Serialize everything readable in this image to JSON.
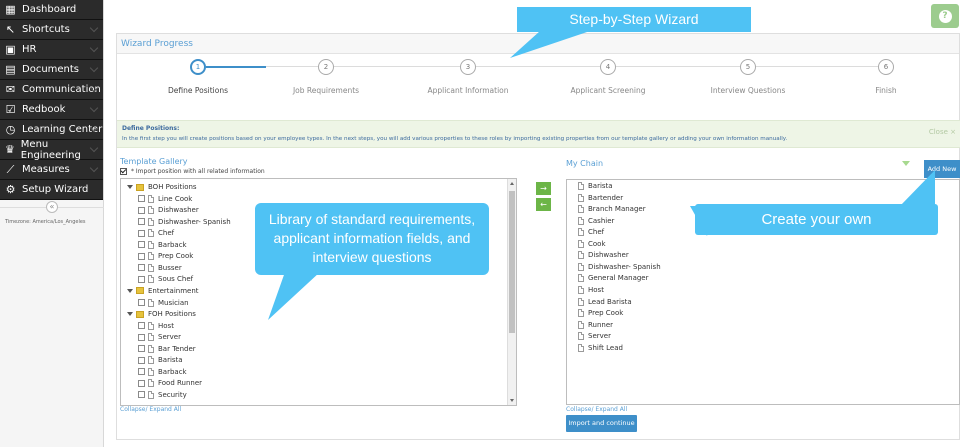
{
  "sidebar": {
    "items": [
      {
        "label": "Dashboard",
        "icon": "grid-icon"
      },
      {
        "label": "Shortcuts",
        "icon": "arrow-icon"
      },
      {
        "label": "HR",
        "icon": "id-card-icon"
      },
      {
        "label": "Documents",
        "icon": "documents-icon"
      },
      {
        "label": "Communication",
        "icon": "envelope-icon"
      },
      {
        "label": "Redbook",
        "icon": "checkbox-icon"
      },
      {
        "label": "Learning Center",
        "icon": "timer-icon"
      },
      {
        "label": "Menu Engineering",
        "icon": "chef-hat-icon"
      },
      {
        "label": "Measures",
        "icon": "ruler-icon"
      },
      {
        "label": "Setup Wizard",
        "icon": "gears-icon"
      }
    ],
    "collapse_glyph": "«",
    "timezone": "Timezone: America/Los_Angeles"
  },
  "help": {
    "glyph": "?"
  },
  "panel": {
    "title": "Wizard Progress"
  },
  "steps": [
    {
      "number": "1",
      "label": "Define Positions"
    },
    {
      "number": "2",
      "label": "Job Requirements"
    },
    {
      "number": "3",
      "label": "Applicant Information"
    },
    {
      "number": "4",
      "label": "Applicant Screening"
    },
    {
      "number": "5",
      "label": "Interview Questions"
    },
    {
      "number": "6",
      "label": "Finish"
    }
  ],
  "active_step": 1,
  "info": {
    "title": "Define Positions:",
    "text": "In the first step you will create positions based on your employee types. In the next steps, you will add various properties to these roles by importing existing properties from our template gallery or adding your own information manually.",
    "close": "Close ×"
  },
  "gallery": {
    "title": "Template Gallery",
    "import_label": "* Import position with all related information",
    "import_checked": true,
    "tree": [
      {
        "type": "group",
        "label": "BOH Positions"
      },
      {
        "type": "item",
        "label": "Line Cook"
      },
      {
        "type": "item",
        "label": "Dishwasher"
      },
      {
        "type": "item",
        "label": "Dishwasher- Spanish"
      },
      {
        "type": "item",
        "label": "Chef"
      },
      {
        "type": "item",
        "label": "Barback"
      },
      {
        "type": "item",
        "label": "Prep Cook"
      },
      {
        "type": "item",
        "label": "Busser"
      },
      {
        "type": "item",
        "label": "Sous Chef"
      },
      {
        "type": "group",
        "label": "Entertainment"
      },
      {
        "type": "item",
        "label": "Musician"
      },
      {
        "type": "group",
        "label": "FOH Positions"
      },
      {
        "type": "item",
        "label": "Host"
      },
      {
        "type": "item",
        "label": "Server"
      },
      {
        "type": "item",
        "label": "Bar Tender"
      },
      {
        "type": "item",
        "label": "Barista"
      },
      {
        "type": "item",
        "label": "Barback"
      },
      {
        "type": "item",
        "label": "Food Runner"
      },
      {
        "type": "item",
        "label": "Security"
      }
    ],
    "collapse_expand": "Collapse/ Expand All"
  },
  "move": {
    "right": "→",
    "left": "←"
  },
  "chain": {
    "title": "My Chain",
    "add_new": "Add New",
    "items": [
      "Barista",
      "Bartender",
      "Branch Manager",
      "Cashier",
      "Chef",
      "Cook",
      "Dishwasher",
      "Dishwasher- Spanish",
      "General Manager",
      "Host",
      "Lead Barista",
      "Prep Cook",
      "Runner",
      "Server",
      "Shift Lead"
    ],
    "collapse_expand": "Collapse/ Expand All",
    "import_button": "Import and continue"
  },
  "callouts": {
    "wizard": "Step-by-Step Wizard",
    "library": "Library of standard requirements, applicant information  fields, and interview questions",
    "create": "Create your own"
  },
  "colors": {
    "accent": "#3e8fc9",
    "callout": "#4fc2f4",
    "sidebar": "#2b2b2b",
    "move_buttons": "#6cb547",
    "info_bg": "#eef5e6"
  }
}
